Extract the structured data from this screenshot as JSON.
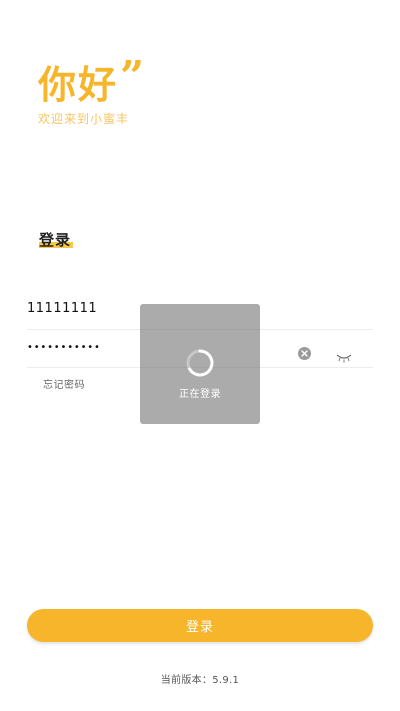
{
  "header": {
    "title": "你好",
    "quote_mark": "”",
    "subtitle": "欢迎来到小蜜丰"
  },
  "login_form": {
    "heading": "登录",
    "account_value": "11111111",
    "password_masked": "•••••••••••",
    "forgot_password": "忘记密码",
    "clear_icon": "clear-circle-icon",
    "eye_icon": "eye-closed-icon"
  },
  "loading_dialog": {
    "text": "正在登录",
    "spinner_icon": "loading-spinner-icon"
  },
  "actions": {
    "login_button": "登录"
  },
  "footer": {
    "version_text": "当前版本：5.9.1"
  },
  "colors": {
    "accent": "#f6b52a",
    "accent_light": "#f7c463",
    "overlay": "#787878"
  }
}
